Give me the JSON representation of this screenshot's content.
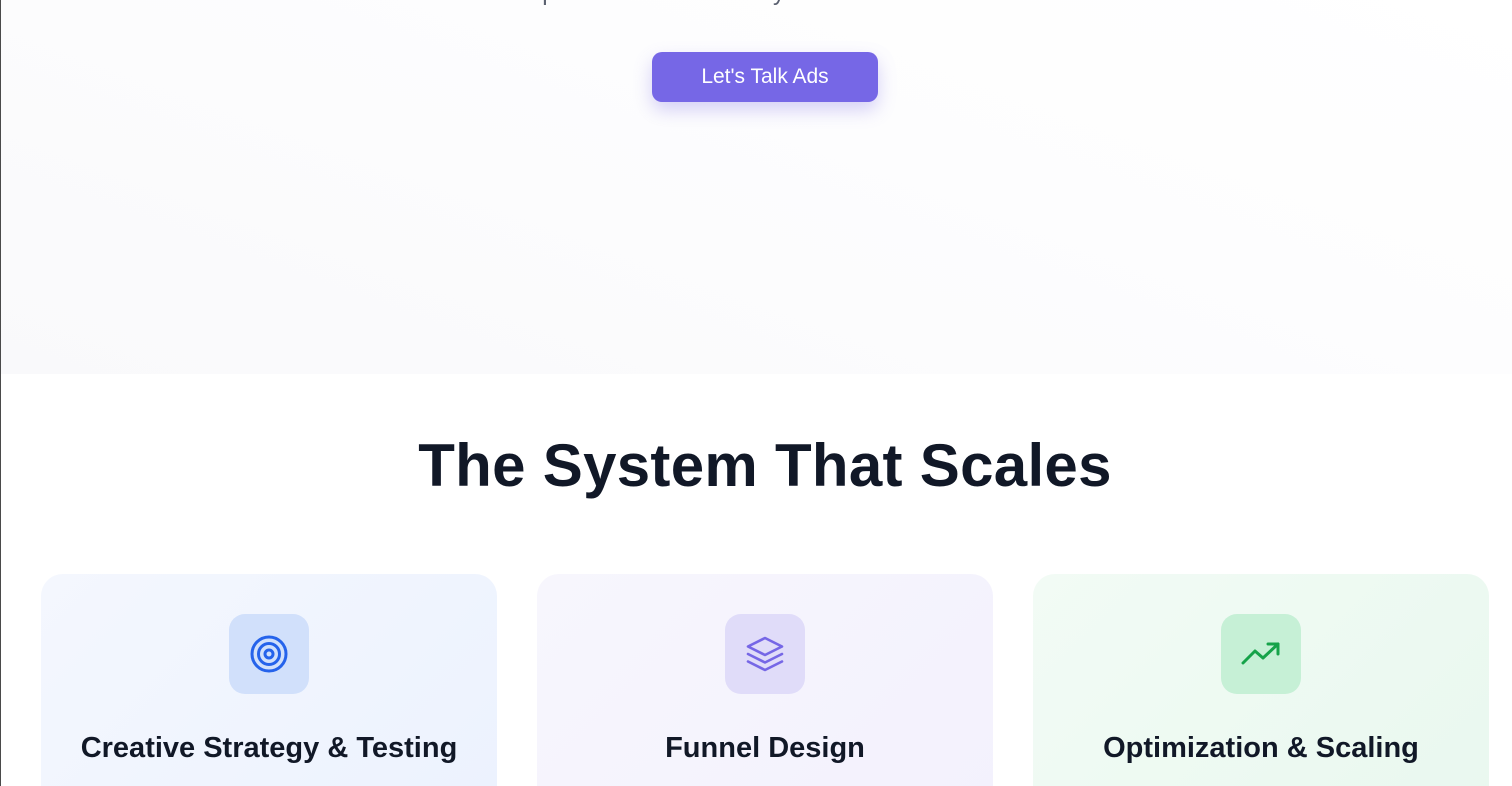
{
  "hero": {
    "subtitle": "optimization — so every dollar works harder.",
    "cta_label": "Let's Talk Ads"
  },
  "section": {
    "title": "The System That Scales"
  },
  "cards": [
    {
      "title": "Creative Strategy & Testing",
      "icon": "target-icon",
      "accent": "#2563eb"
    },
    {
      "title": "Funnel Design",
      "icon": "layers-icon",
      "accent": "#7667e6"
    },
    {
      "title": "Optimization & Scaling",
      "icon": "trending-up-icon",
      "accent": "#16a34a"
    }
  ],
  "colors": {
    "cta_background": "#7667e6",
    "heading": "#111827"
  }
}
